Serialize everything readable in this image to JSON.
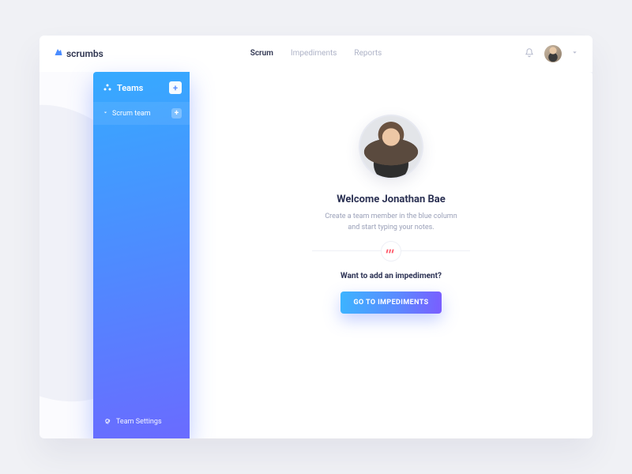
{
  "brand": {
    "name": "scrumbs"
  },
  "nav": {
    "items": [
      {
        "label": "Scrum",
        "active": true
      },
      {
        "label": "Impediments",
        "active": false
      },
      {
        "label": "Reports",
        "active": false
      }
    ]
  },
  "sidebar": {
    "title": "Teams",
    "items": [
      {
        "label": "Scrum team"
      }
    ],
    "footer_label": "Team Settings"
  },
  "main": {
    "welcome": "Welcome Jonathan Bae",
    "subtext_line1": "Create a team member in the blue column",
    "subtext_line2": "and start typing your notes.",
    "prompt": "Want to add an impediment?",
    "cta_label": "GO TO IMPEDIMENTS"
  },
  "colors": {
    "accent_start": "#36aaff",
    "accent_end": "#6a6bff",
    "text_dark": "#2b3153",
    "text_muted": "#9aa0b8"
  }
}
